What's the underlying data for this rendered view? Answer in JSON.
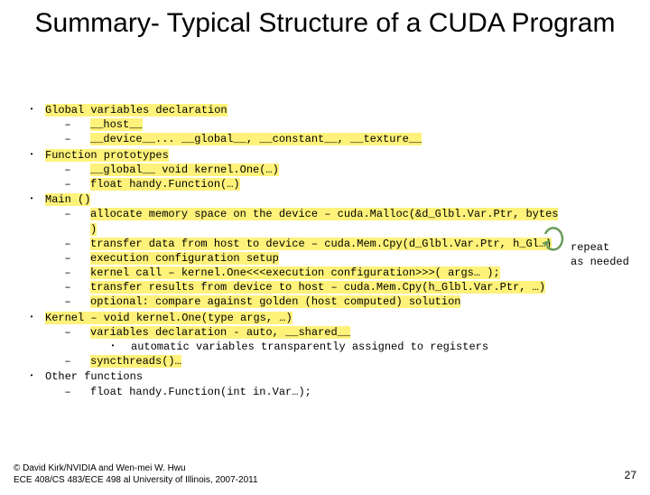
{
  "title": "Summary- Typical Structure of a CUDA Program",
  "sections": [
    {
      "head": "Global variables declaration",
      "hl": true,
      "subs": [
        {
          "l": 1,
          "t": "__host__",
          "hl": true
        },
        {
          "l": 1,
          "t": "__device__... __global__, __constant__, __texture__",
          "hl": true
        }
      ]
    },
    {
      "head": "Function prototypes",
      "hl": true,
      "subs": [
        {
          "l": 1,
          "t": "__global__ void kernel.One(…)",
          "hl": true
        },
        {
          "l": 1,
          "t": "float handy.Function(…)",
          "hl": true
        }
      ]
    },
    {
      "head": "Main ()",
      "hl": true,
      "subs": [
        {
          "l": 1,
          "t": "allocate memory space on the device – cuda.Malloc(&d_Glbl.Var.Ptr, bytes )",
          "hl": true
        },
        {
          "l": 1,
          "t": "transfer data from host to device – cuda.Mem.Cpy(d_Glbl.Var.Ptr, h_Gl…)",
          "hl": true
        },
        {
          "l": 1,
          "t": "execution configuration setup",
          "hl": true
        },
        {
          "l": 1,
          "t": "kernel call – kernel.One<<<execution configuration>>>( args… );",
          "hl": true
        },
        {
          "l": 1,
          "t": "transfer results from device to host – cuda.Mem.Cpy(h_Glbl.Var.Ptr, …)",
          "hl": true
        },
        {
          "l": 1,
          "t": "optional: compare against golden (host computed) solution",
          "hl": true
        }
      ]
    },
    {
      "head": "Kernel – void kernel.One(type args, …)",
      "hl": true,
      "subs": [
        {
          "l": 1,
          "t": "variables declaration - auto, __shared__",
          "hl": true
        },
        {
          "l": 2,
          "t": "automatic variables transparently assigned to registers",
          "hl": false
        },
        {
          "l": 1,
          "t": "syncthreads()…",
          "hl": true
        }
      ]
    },
    {
      "head": "Other functions",
      "hl": false,
      "subs": [
        {
          "l": 1,
          "t": "float handy.Function(int in.Var…);",
          "hl": false
        }
      ]
    }
  ],
  "annotation": {
    "line1": "repeat",
    "line2": "as needed"
  },
  "footer": {
    "line1": "© David Kirk/NVIDIA and Wen-mei W. Hwu",
    "line2": "ECE 408/CS 483/ECE 498 al University of Illinois, 2007-2011"
  },
  "page": "27"
}
